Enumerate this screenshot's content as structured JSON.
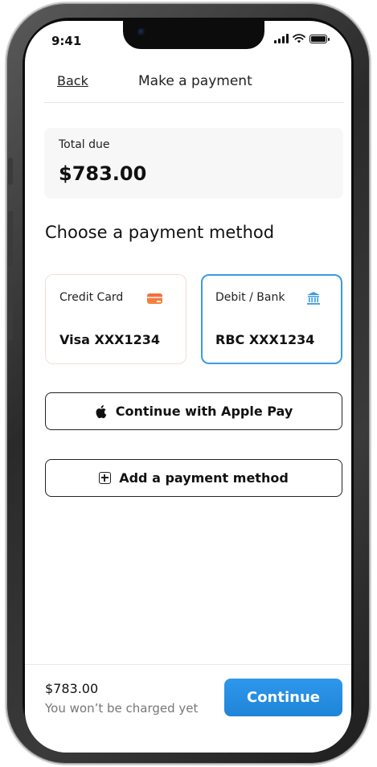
{
  "status_bar": {
    "time": "9:41"
  },
  "header": {
    "back_label": "Back",
    "title": "Make a payment"
  },
  "total": {
    "label": "Total due",
    "amount": "$783.00"
  },
  "section_title": "Choose a payment method",
  "payment_methods": [
    {
      "label": "Credit Card",
      "value": "Visa XXX1234",
      "icon": "credit-card-icon",
      "selected": false
    },
    {
      "label": "Debit / Bank",
      "value": "RBC XXX1234",
      "icon": "bank-icon",
      "selected": true
    }
  ],
  "apple_pay": {
    "label": "Continue with Apple Pay",
    "icon": "apple-icon"
  },
  "add_method": {
    "label": "Add a payment method",
    "icon": "plus-square-icon"
  },
  "footer": {
    "amount": "$783.00",
    "note": "You won’t be charged yet",
    "continue_label": "Continue"
  },
  "colors": {
    "accent": "#2f98ec",
    "selected_border": "#3a9be0",
    "card_icon": "#f46a3d",
    "bank_icon": "#3a9be0"
  }
}
